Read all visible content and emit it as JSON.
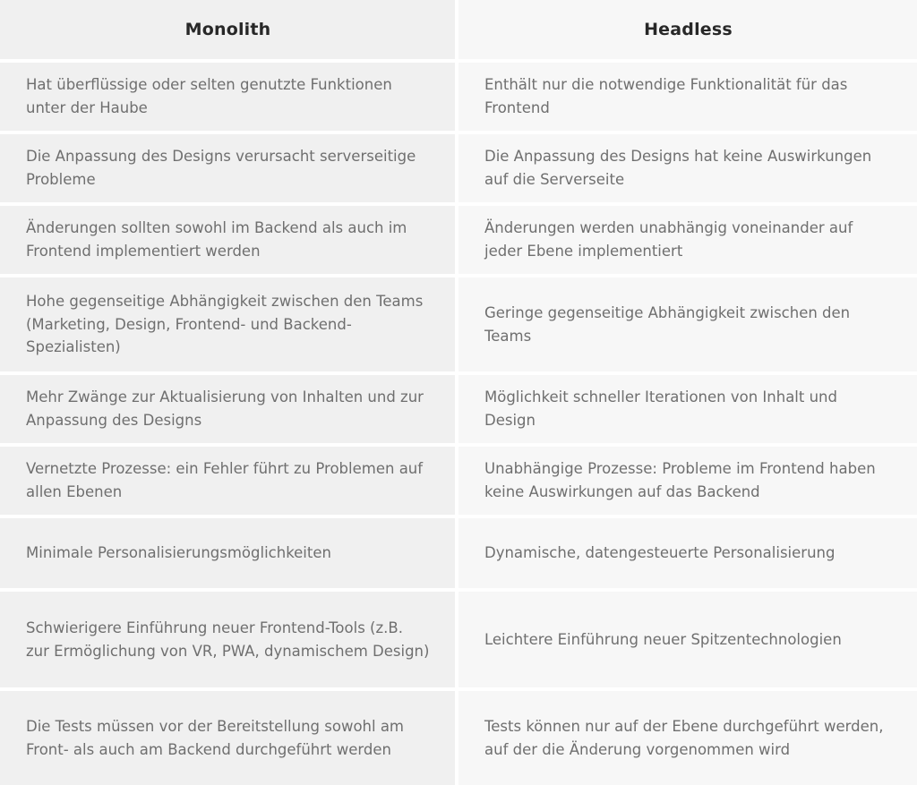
{
  "table": {
    "columns": [
      {
        "id": "monolith",
        "label": "Monolith"
      },
      {
        "id": "headless",
        "label": "Headless"
      }
    ],
    "rows": [
      {
        "monolith": "Hat überflüssige oder selten genutzte Funktionen unter der Haube",
        "headless": "Enthält nur die notwendige Funktionalität für das Frontend"
      },
      {
        "monolith": "Die Anpassung des Designs verursacht serverseitige Probleme",
        "headless": "Die Anpassung des Designs hat keine Auswirkungen auf die Serverseite"
      },
      {
        "monolith": "Änderungen sollten sowohl im Backend als auch im Frontend implementiert werden",
        "headless": "Änderungen werden unabhängig voneinander auf jeder Ebene implementiert"
      },
      {
        "monolith": "Hohe gegenseitige Abhängigkeit zwischen den Teams (Marketing, Design, Frontend- und Backend-Spezialisten)",
        "headless": "Geringe gegenseitige Abhängigkeit zwischen den Teams"
      },
      {
        "monolith": "Mehr Zwänge zur Aktualisierung von Inhalten und zur Anpassung des Designs",
        "headless": "Möglichkeit schneller Iterationen von Inhalt und Design"
      },
      {
        "monolith": "Vernetzte Prozesse: ein Fehler führt zu Problemen auf allen Ebenen",
        "headless": "Unabhängige Prozesse: Probleme im Frontend haben keine Auswirkungen auf das Backend"
      },
      {
        "monolith": "Minimale Personalisierungsmöglichkeiten",
        "headless": "Dynamische, datengesteuerte Personalisierung"
      },
      {
        "monolith": "Schwierigere Einführung neuer Frontend-Tools (z.B. zur Ermöglichung von VR, PWA, dynamischem Design)",
        "headless": "Leichtere Einführung neuer Spitzentechnologien"
      },
      {
        "monolith": "Die Tests müssen vor der Bereitstellung sowohl am Front- als auch am Backend durchgeführt werden",
        "headless": "Tests können nur auf der Ebene durchgeführt werden, auf der die Änderung vorgenommen wird"
      }
    ]
  },
  "colors": {
    "column_left_background": "#f0f0f0",
    "column_right_background": "#f7f7f7",
    "separator": "#ffffff",
    "header_text": "#282828",
    "body_text": "#6f6f6f"
  }
}
